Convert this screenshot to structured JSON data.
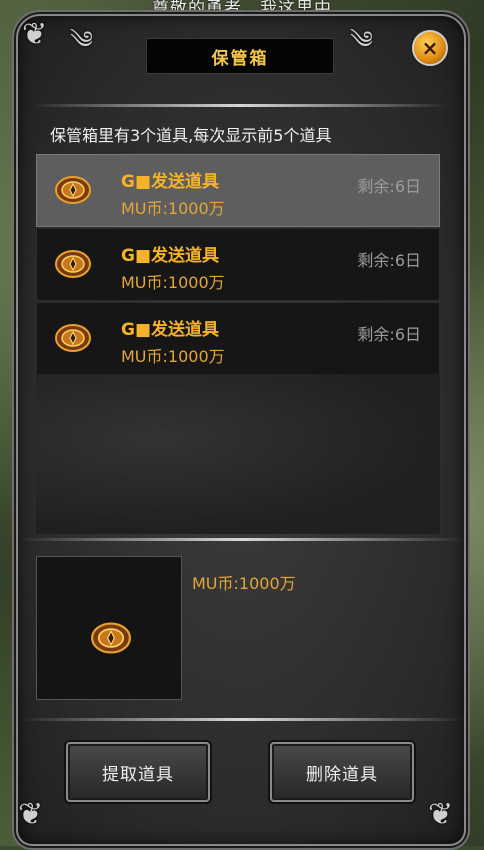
{
  "background": {
    "text": "尊敬的勇者，我这里中"
  },
  "window": {
    "title": "保管箱",
    "close_label": "×",
    "info_text": "保管箱里有3个道具,每次显示前5个道具"
  },
  "items": [
    {
      "name": "G■发送道具",
      "price": "MU币:1000万",
      "remaining": "剩余:6日",
      "icon": "round-amulet-icon",
      "selected": true
    },
    {
      "name": "G■发送道具",
      "price": "MU币:1000万",
      "remaining": "剩余:6日",
      "icon": "round-amulet-icon",
      "selected": false
    },
    {
      "name": "G■发送道具",
      "price": "MU币:1000万",
      "remaining": "剩余:6日",
      "icon": "round-amulet-icon",
      "selected": false
    }
  ],
  "preview": {
    "price": "MU币:1000万",
    "icon": "round-amulet-icon"
  },
  "buttons": {
    "retrieve": "提取道具",
    "delete": "删除道具"
  },
  "colors": {
    "gold_text": "#f5b22a",
    "price_text": "#e3a63c",
    "title_text": "#f5c84a",
    "selected_row": "#5e5e5e"
  }
}
